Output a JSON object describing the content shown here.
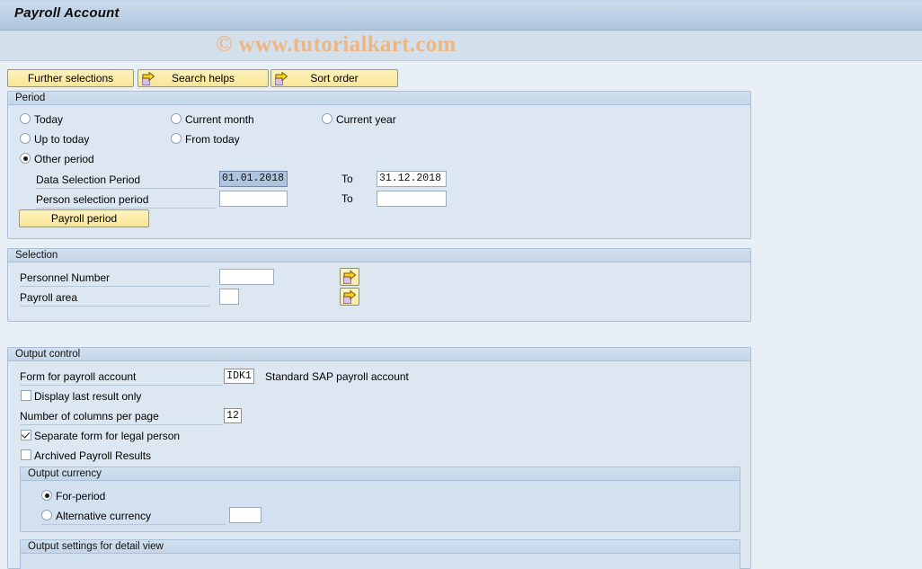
{
  "window": {
    "title": "Payroll Account",
    "watermark": "© www.tutorialkart.com"
  },
  "toolbar": {
    "buttons": [
      {
        "label": "Further selections",
        "icon": ""
      },
      {
        "label": "Search helps",
        "icon": "arrow-page-icon"
      },
      {
        "label": "Sort order",
        "icon": "arrow-page-icon"
      }
    ]
  },
  "period": {
    "title": "Period",
    "radios": [
      {
        "label": "Today",
        "selected": false
      },
      {
        "label": "Current month",
        "selected": false
      },
      {
        "label": "Current year",
        "selected": false
      },
      {
        "label": "Up to today",
        "selected": false
      },
      {
        "label": "From today",
        "selected": false
      },
      {
        "label": "Other period",
        "selected": true
      }
    ],
    "data_selection_period": {
      "label": "Data Selection Period",
      "from_value": "01.01.2018",
      "to_label": "To",
      "to_value": "31.12.2018"
    },
    "person_selection_period": {
      "label": "Person selection period",
      "from_value": "",
      "to_label": "To",
      "to_value": ""
    },
    "payroll_period_button": "Payroll period"
  },
  "selection": {
    "title": "Selection",
    "personnel_number": {
      "label": "Personnel Number",
      "value": ""
    },
    "payroll_area": {
      "label": "Payroll area",
      "value": ""
    },
    "multi_select_icon": "arrow-page-icon"
  },
  "output_control": {
    "title": "Output control",
    "form_for_payroll_account": {
      "label": "Form for payroll account",
      "value": "IDK1",
      "description": "Standard SAP payroll account"
    },
    "display_last_result_only": {
      "label": "Display last result only",
      "checked": false
    },
    "number_of_columns_per_page": {
      "label": "Number of columns per page",
      "value": "12"
    },
    "separate_form_for_legal_person": {
      "label": "Separate form for legal person",
      "checked": true
    },
    "archived_payroll_results": {
      "label": "Archived Payroll Results",
      "checked": false
    },
    "output_currency": {
      "title": "Output currency",
      "for_period": {
        "label": "For-period",
        "selected": true
      },
      "alternative_currency": {
        "label": "Alternative currency",
        "selected": false,
        "value": ""
      }
    },
    "output_settings_detail_view": {
      "title": "Output settings for detail view"
    }
  },
  "colors": {
    "titlebar": "#c0d2e6",
    "canvas": "#e9eff7",
    "group_bg": "#dce7f2",
    "group_border": "#a9c0d8",
    "button_yellow": "#fbeca8",
    "watermark": "#edb683",
    "field_selected": "#aec5e0"
  }
}
